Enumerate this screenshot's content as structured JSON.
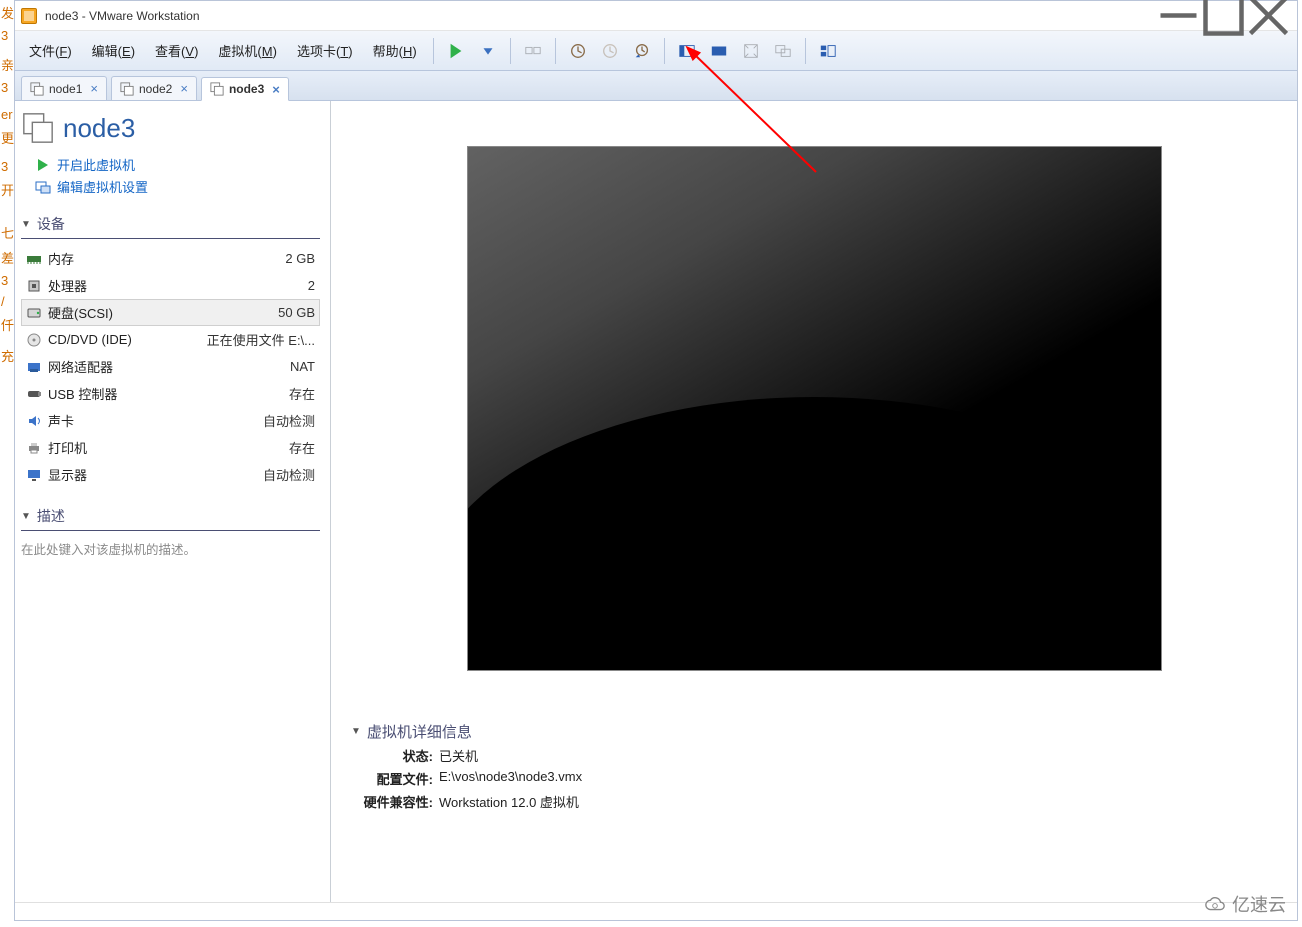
{
  "window": {
    "title": "node3 - VMware Workstation"
  },
  "menu": {
    "file": {
      "label": "文件",
      "hot": "F"
    },
    "edit": {
      "label": "编辑",
      "hot": "E"
    },
    "view": {
      "label": "查看",
      "hot": "V"
    },
    "vm": {
      "label": "虚拟机",
      "hot": "M"
    },
    "tabs": {
      "label": "选项卡",
      "hot": "T"
    },
    "help": {
      "label": "帮助",
      "hot": "H"
    }
  },
  "tabs": [
    {
      "label": "node1",
      "active": false
    },
    {
      "label": "node2",
      "active": false
    },
    {
      "label": "node3",
      "active": true
    }
  ],
  "vm": {
    "name": "node3",
    "actions": {
      "power_on": "开启此虚拟机",
      "edit_settings": "编辑虚拟机设置"
    },
    "sections": {
      "devices": "设备",
      "description": "描述",
      "details": "虚拟机详细信息"
    },
    "description_placeholder": "在此处键入对该虚拟机的描述。",
    "devices": [
      {
        "icon": "memory-icon",
        "name": "内存",
        "value": "2 GB",
        "selected": false
      },
      {
        "icon": "cpu-icon",
        "name": "处理器",
        "value": "2",
        "selected": false
      },
      {
        "icon": "hdd-icon",
        "name": "硬盘(SCSI)",
        "value": "50 GB",
        "selected": true
      },
      {
        "icon": "disc-icon",
        "name": "CD/DVD (IDE)",
        "value": "正在使用文件 E:\\...",
        "selected": false
      },
      {
        "icon": "nic-icon",
        "name": "网络适配器",
        "value": "NAT",
        "selected": false
      },
      {
        "icon": "usb-icon",
        "name": "USB 控制器",
        "value": "存在",
        "selected": false
      },
      {
        "icon": "sound-icon",
        "name": "声卡",
        "value": "自动检测",
        "selected": false
      },
      {
        "icon": "printer-icon",
        "name": "打印机",
        "value": "存在",
        "selected": false
      },
      {
        "icon": "display-icon",
        "name": "显示器",
        "value": "自动检测",
        "selected": false
      }
    ],
    "details": {
      "state_label": "状态:",
      "state": "已关机",
      "cfg_label": "配置文件:",
      "cfg": "E:\\vos\\node3\\node3.vmx",
      "hw_label": "硬件兼容性:",
      "hw": "Workstation 12.0 虚拟机"
    }
  },
  "watermark": "亿速云"
}
